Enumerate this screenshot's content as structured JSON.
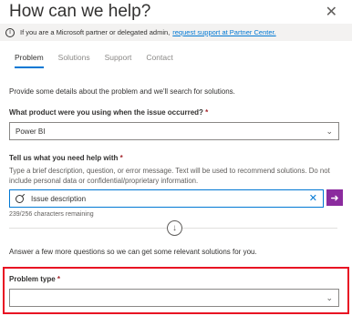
{
  "panel": {
    "title": "How can we help?"
  },
  "banner": {
    "text": "If you are a Microsoft partner or delegated admin,",
    "link": "request support at Partner Center."
  },
  "tabs": [
    {
      "label": "Problem",
      "active": true
    },
    {
      "label": "Solutions",
      "active": false
    },
    {
      "label": "Support",
      "active": false
    },
    {
      "label": "Contact",
      "active": false
    }
  ],
  "form": {
    "intro": "Provide some details about the problem and we'll search for solutions.",
    "product_label": "What product were you using when the issue occurred?",
    "product_value": "Power BI",
    "help_label": "Tell us what you need help with",
    "help_hint": "Type a brief description, question, or error message. Text will be used to recommend solutions. Do not include personal data or confidential/proprietary information.",
    "search_value": "Issue description",
    "counter": "239/256 characters remaining",
    "more_questions": "Answer a few more questions so we can get some relevant solutions for you.",
    "problem_type_label": "Problem type",
    "problem_type_value": "",
    "required_mark": "*"
  },
  "colors": {
    "accent": "#0078d4",
    "go_button": "#8b2b9e",
    "highlight": "#e81123"
  }
}
